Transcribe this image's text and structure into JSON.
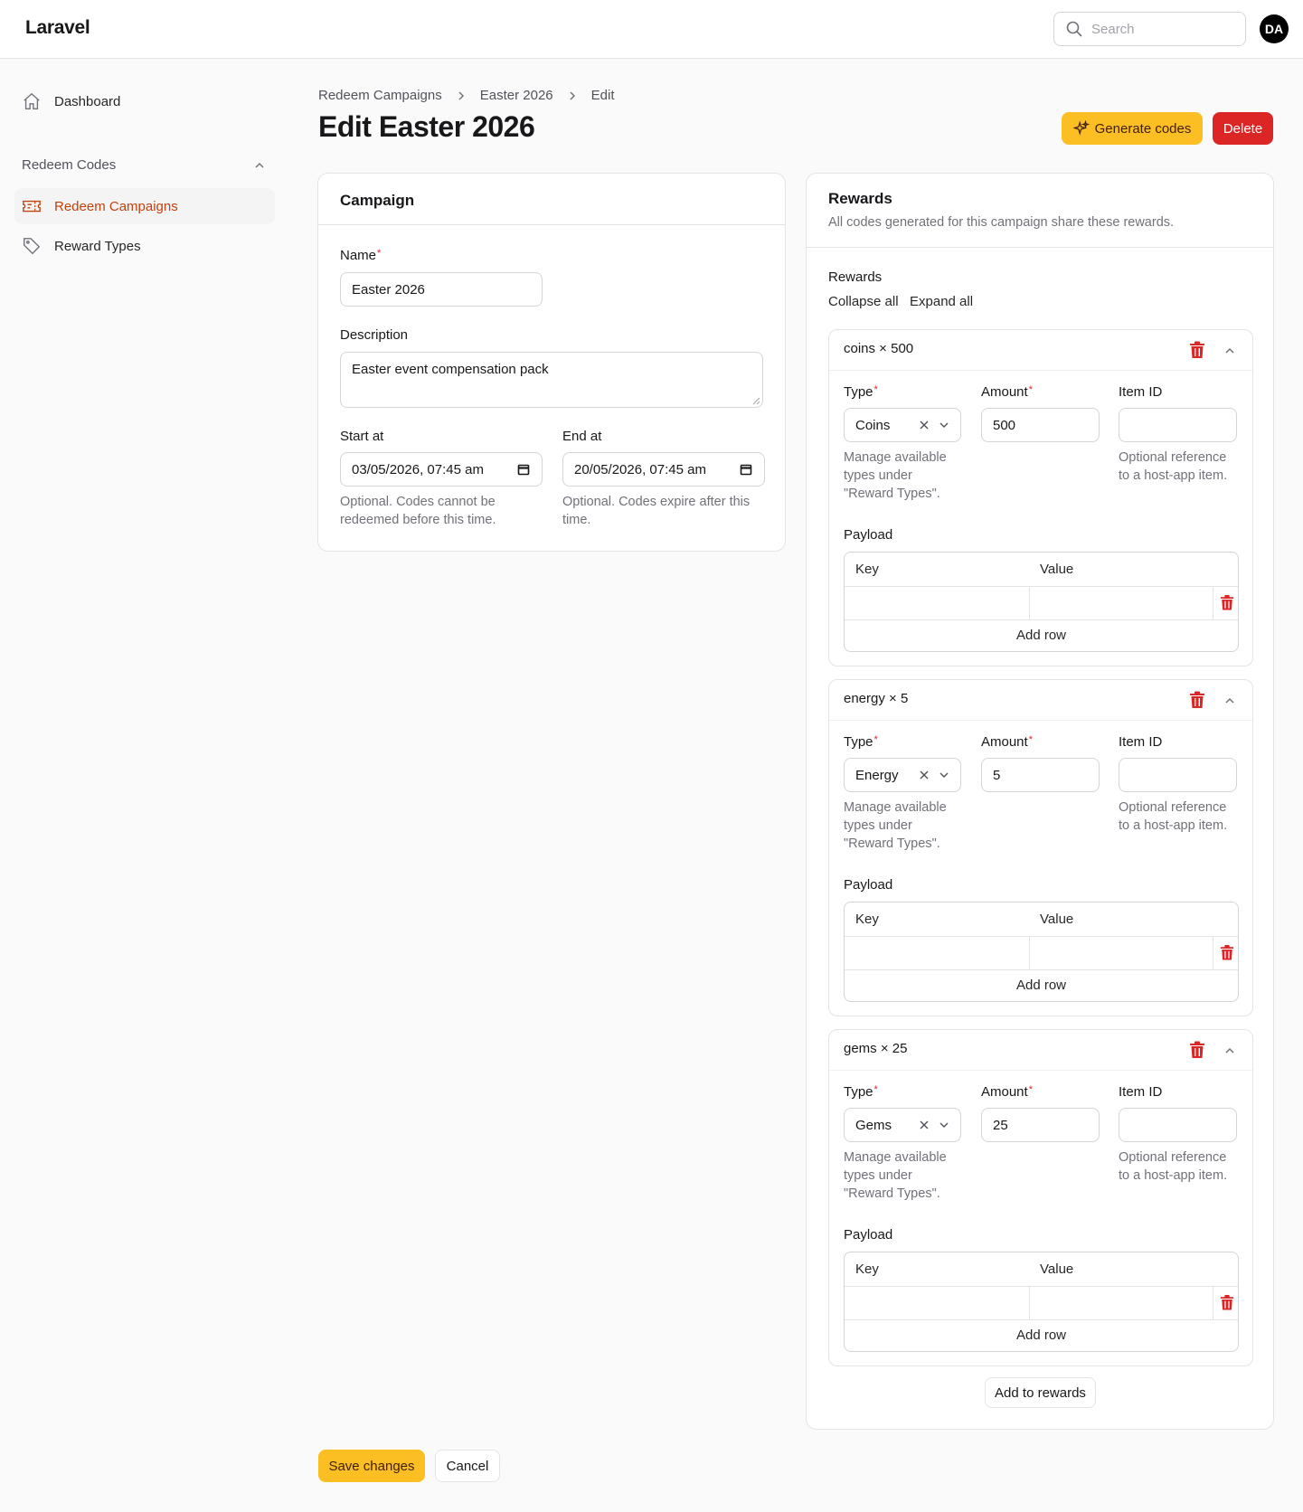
{
  "app": {
    "brand": "Laravel",
    "search_placeholder": "Search",
    "user_initials": "DA"
  },
  "sidebar": {
    "dashboard": "Dashboard",
    "group": "Redeem Codes",
    "items": [
      {
        "label": "Redeem Campaigns",
        "active": true
      },
      {
        "label": "Reward Types",
        "active": false
      }
    ]
  },
  "breadcrumb": [
    "Redeem Campaigns",
    "Easter 2026",
    "Edit"
  ],
  "page_title": "Edit Easter 2026",
  "header_actions": {
    "generate": "Generate codes",
    "delete": "Delete"
  },
  "campaign": {
    "title": "Campaign",
    "name_label": "Name",
    "name_value": "Easter 2026",
    "description_label": "Description",
    "description_value": "Easter event compensation pack",
    "start_label": "Start at",
    "start_value": "03/05/2026, 07:45 am",
    "start_help": "Optional. Codes cannot be redeemed before this time.",
    "end_label": "End at",
    "end_value": "20/05/2026, 07:45 am",
    "end_help": "Optional. Codes expire after this time."
  },
  "rewards": {
    "title": "Rewards",
    "subtitle": "All codes generated for this campaign share these rewards.",
    "list_label": "Rewards",
    "collapse_all": "Collapse all",
    "expand_all": "Expand all",
    "type_label": "Type",
    "amount_label": "Amount",
    "item_id_label": "Item ID",
    "type_help": "Manage available types under \"Reward Types\".",
    "item_id_help": "Optional reference to a host-app item.",
    "payload_label": "Payload",
    "key_col": "Key",
    "value_col": "Value",
    "add_row": "Add row",
    "items": [
      {
        "title": "coins × 500",
        "type": "Coins",
        "amount": "500",
        "item_id": ""
      },
      {
        "title": "energy × 5",
        "type": "Energy",
        "amount": "5",
        "item_id": ""
      },
      {
        "title": "gems × 25",
        "type": "Gems",
        "amount": "25",
        "item_id": ""
      }
    ],
    "add_button": "Add to rewards"
  },
  "footer": {
    "save": "Save changes",
    "cancel": "Cancel"
  },
  "colors": {
    "accent": "#fbbf24",
    "danger": "#dc2626",
    "active_nav": "#c2410c"
  }
}
